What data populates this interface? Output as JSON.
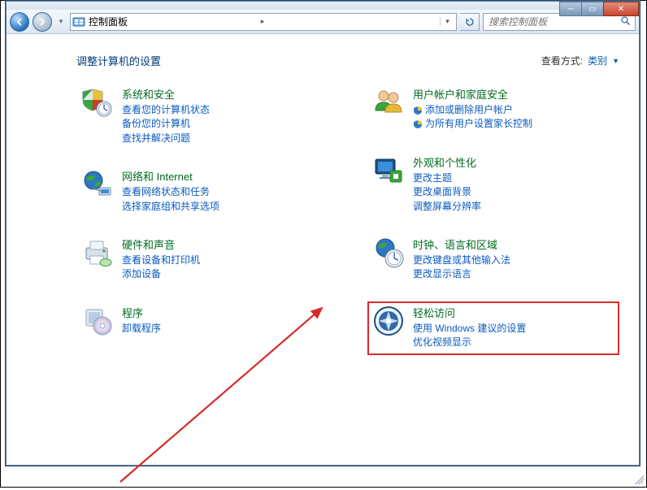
{
  "window": {
    "breadcrumb_icon": "control-panel-icon",
    "breadcrumb_text": "控制面板",
    "search_placeholder": "搜索控制面板"
  },
  "content": {
    "heading": "调整计算机的设置",
    "view_by_label": "查看方式:",
    "view_by_value": "类别"
  },
  "left_categories": [
    {
      "id": "system-security",
      "title": "系统和安全",
      "links": [
        "查看您的计算机状态",
        "备份您的计算机",
        "查找并解决问题"
      ]
    },
    {
      "id": "network-internet",
      "title": "网络和 Internet",
      "links": [
        "查看网络状态和任务",
        "选择家庭组和共享选项"
      ]
    },
    {
      "id": "hardware-sound",
      "title": "硬件和声音",
      "links": [
        "查看设备和打印机",
        "添加设备"
      ]
    },
    {
      "id": "programs",
      "title": "程序",
      "links": [
        "卸载程序"
      ]
    }
  ],
  "right_categories": [
    {
      "id": "user-accounts",
      "title": "用户帐户和家庭安全",
      "links_shield": [
        "添加或删除用户帐户",
        "为所有用户设置家长控制"
      ]
    },
    {
      "id": "appearance",
      "title": "外观和个性化",
      "links": [
        "更改主题",
        "更改桌面背景",
        "调整屏幕分辨率"
      ]
    },
    {
      "id": "clock-region",
      "title": "时钟、语言和区域",
      "links": [
        "更改键盘或其他输入法",
        "更改显示语言"
      ]
    },
    {
      "id": "ease-of-access",
      "title": "轻松访问",
      "links": [
        "使用 Windows 建议的设置",
        "优化视频显示"
      ],
      "highlight": true
    }
  ],
  "annotation": {
    "highlight_color": "#d62b2b",
    "arrow_color": "#d62b2b"
  }
}
